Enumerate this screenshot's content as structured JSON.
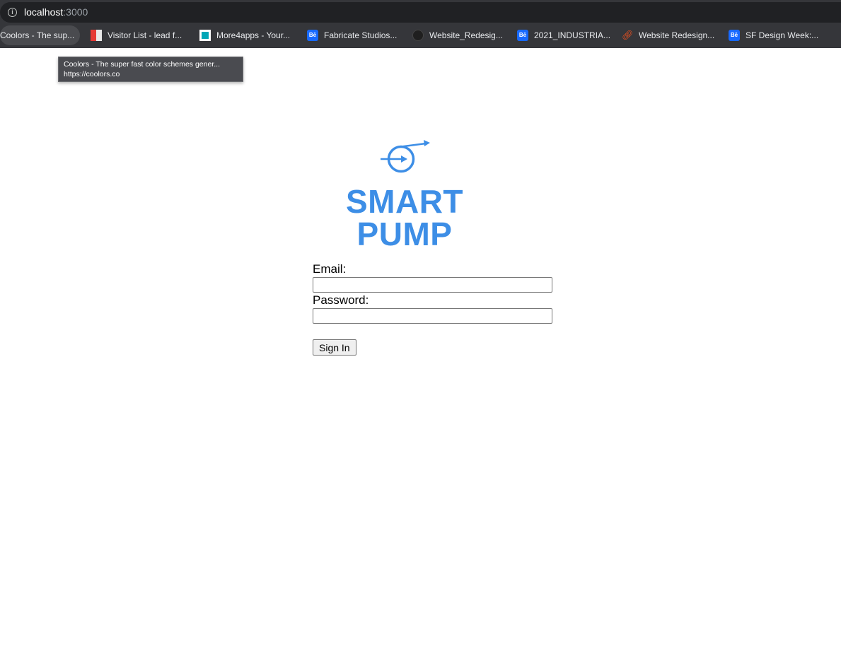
{
  "browser": {
    "url_host": "localhost",
    "url_port": ":3000",
    "bookmarks": [
      {
        "label": "Coolors - The sup...",
        "icon": "coolors-icon"
      },
      {
        "label": "Visitor List - lead f...",
        "icon": "leadfeeder-icon"
      },
      {
        "label": "More4apps - Your...",
        "icon": "more4apps-icon"
      },
      {
        "label": "Fabricate Studios...",
        "icon": "behance-icon"
      },
      {
        "label": "Website_Redesig...",
        "icon": "notion-icon"
      },
      {
        "label": "2021_INDUSTRIA...",
        "icon": "behance-icon"
      },
      {
        "label": "Website Redesign...",
        "icon": "link-icon"
      },
      {
        "label": "SF Design Week:...",
        "icon": "behance-icon"
      }
    ],
    "tooltip": {
      "title": "Coolors - The super fast color schemes gener...",
      "url": "https://coolors.co"
    }
  },
  "logo": {
    "line1": "SMART",
    "line2": "PUMP",
    "color": "#3d8ee6"
  },
  "form": {
    "email_label": "Email:",
    "email_value": "",
    "password_label": "Password:",
    "password_value": "",
    "submit_label": "Sign In"
  }
}
